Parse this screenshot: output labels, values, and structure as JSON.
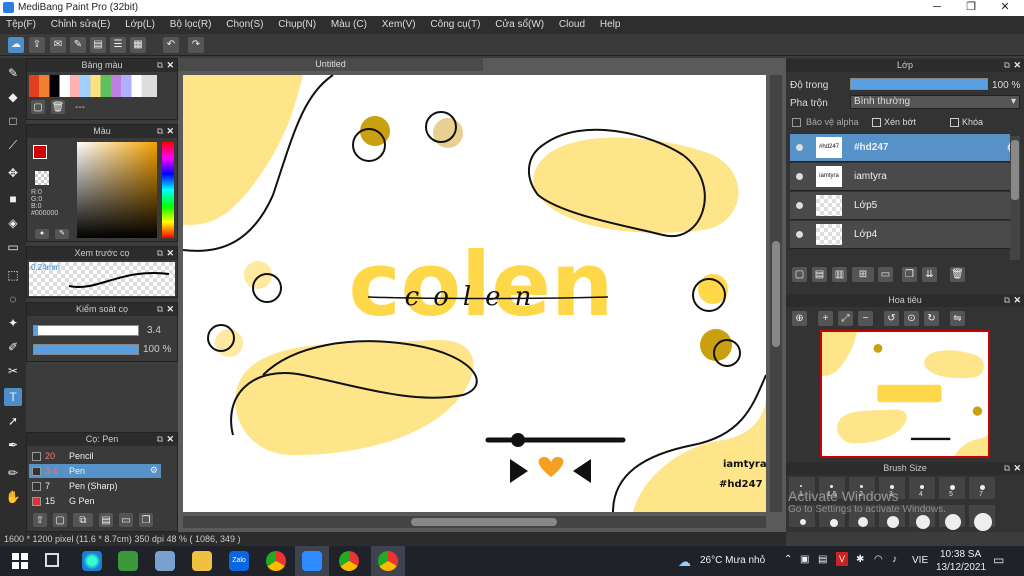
{
  "window": {
    "title": "MediBang Paint Pro (32bit)",
    "minimize": "─",
    "maximize": "❐",
    "close": "✕"
  },
  "menu": [
    "Tệp(F)",
    "Chỉnh sửa(E)",
    "Lớp(L)",
    "Bộ lọc(R)",
    "Chọn(S)",
    "Chụp(N)",
    "Màu (C)",
    "Xem(V)",
    "Công cụ(T)",
    "Cửa sổ(W)",
    "Cloud",
    "Help"
  ],
  "panels": {
    "palette": "Bảng màu",
    "palette_more": "---",
    "color": "Màu",
    "color_values": {
      "r": "R:0",
      "g": "G:0",
      "b": "B:0",
      "hex": "#000000"
    },
    "preview": "Xem trước cọ",
    "preview_size": "0.24mm",
    "control": "Kiểm soát cọ",
    "size_value": "3.4",
    "opacity_value": "100 %",
    "brush_panel": "Cọ: Pen"
  },
  "brushes": [
    {
      "size": "20",
      "name": "Pencil",
      "color": "#333333"
    },
    {
      "size": "3.4",
      "name": "Pen",
      "color": "#333333",
      "selected": true
    },
    {
      "size": "7",
      "name": "Pen (Sharp)",
      "color": "#333333"
    },
    {
      "size": "15",
      "name": "G Pen",
      "color": "#e03030"
    }
  ],
  "canvas": {
    "tab": "Untitled",
    "signature": "iamtyra",
    "hashtag": "#hd247",
    "word_script": "colen",
    "word_big": "colen"
  },
  "layers": {
    "title": "Lớp",
    "opacity_label": "Độ trong",
    "opacity_value": "100 %",
    "opacity_fraction": 1.0,
    "blend_label": "Pha trộn",
    "blend_value": "Bình thường",
    "protect_alpha": "Bảo vệ alpha",
    "clipping": "Xén bớt",
    "lock": "Khóa",
    "items": [
      {
        "name": "#hd247",
        "thumb": "#hd247",
        "selected": true
      },
      {
        "name": "iamtyra",
        "thumb": "iamtyra"
      },
      {
        "name": "Lớp5"
      },
      {
        "name": "Lớp4"
      }
    ]
  },
  "navigator": {
    "title": "Hoa tiêu"
  },
  "brush_size": {
    "title": "Brush Size",
    "labels": [
      "1",
      "1.5",
      "2",
      "3",
      "4",
      "5",
      "7"
    ]
  },
  "watermark": {
    "line1": "Activate Windows",
    "line2": "Go to Settings to activate Windows."
  },
  "status": {
    "text": "1600 * 1200 pixel  (11.6 * 8.7cm)  350 dpi  48 %  ( 1086, 349 )"
  },
  "taskbar": {
    "weather": "26°C  Mưa nhỏ",
    "lang": "VIE",
    "time": "10:38 SA",
    "date": "13/12/2021"
  },
  "colors": {
    "accent": "#5691c8",
    "yellow": "#ffd84a",
    "paleyellow": "#ffe58a"
  }
}
